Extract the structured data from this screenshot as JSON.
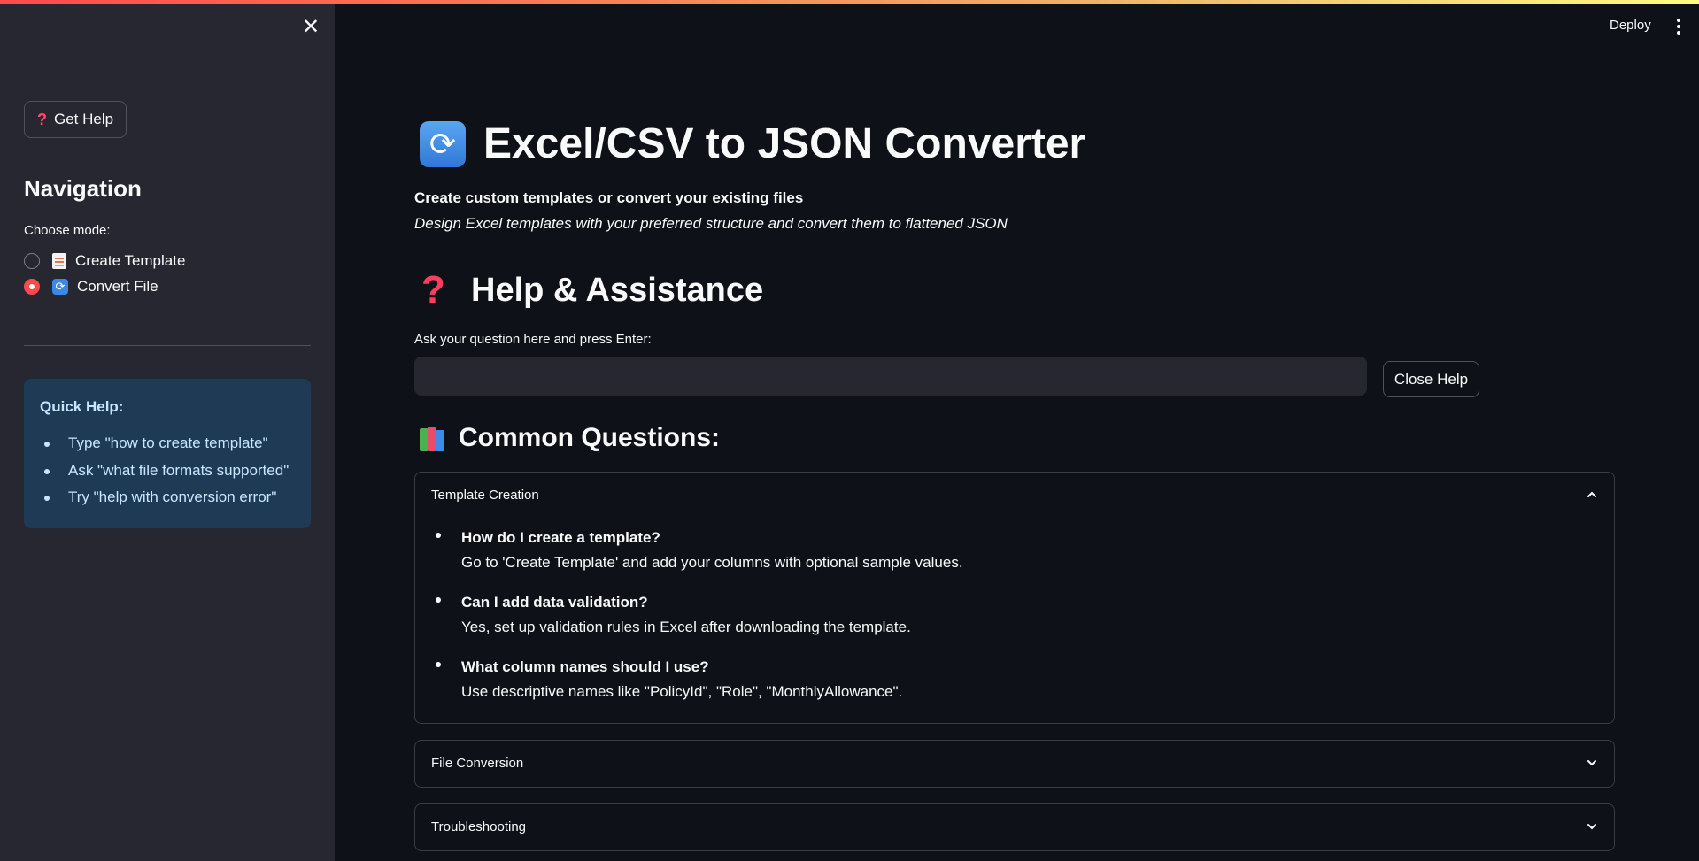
{
  "sidebar": {
    "get_help_label": "Get Help",
    "nav_title": "Navigation",
    "mode_label": "Choose mode:",
    "modes": [
      {
        "label": "Create Template",
        "selected": false
      },
      {
        "label": "Convert File",
        "selected": true
      }
    ],
    "quick_help": {
      "title": "Quick Help:",
      "items": [
        "Type \"how to create template\"",
        "Ask \"what file formats supported\"",
        "Try \"help with conversion error\""
      ]
    }
  },
  "header": {
    "deploy_label": "Deploy"
  },
  "main": {
    "title": "Excel/CSV to JSON Converter",
    "subtitle": "Create custom templates or convert your existing files",
    "description": "Design Excel templates with your preferred structure and convert them to flattened JSON",
    "help_title": "Help & Assistance",
    "ask_label": "Ask your question here and press Enter:",
    "ask_value": "",
    "close_help_label": "Close Help",
    "common_title": "Common Questions:",
    "expanders": [
      {
        "title": "Template Creation",
        "expanded": true,
        "items": [
          {
            "q": "How do I create a template?",
            "a": "Go to 'Create Template' and add your columns with optional sample values."
          },
          {
            "q": "Can I add data validation?",
            "a": "Yes, set up validation rules in Excel after downloading the template."
          },
          {
            "q": "What column names should I use?",
            "a": "Use descriptive names like \"PolicyId\", \"Role\", \"MonthlyAllowance\"."
          }
        ]
      },
      {
        "title": "File Conversion",
        "expanded": false
      },
      {
        "title": "Troubleshooting",
        "expanded": false
      }
    ]
  },
  "colors": {
    "background": "#0e1117",
    "sidebar": "#262730",
    "accent": "#ff4b4b",
    "quick_help_bg": "#1e3a55",
    "quick_help_text": "#c7e6ff"
  }
}
